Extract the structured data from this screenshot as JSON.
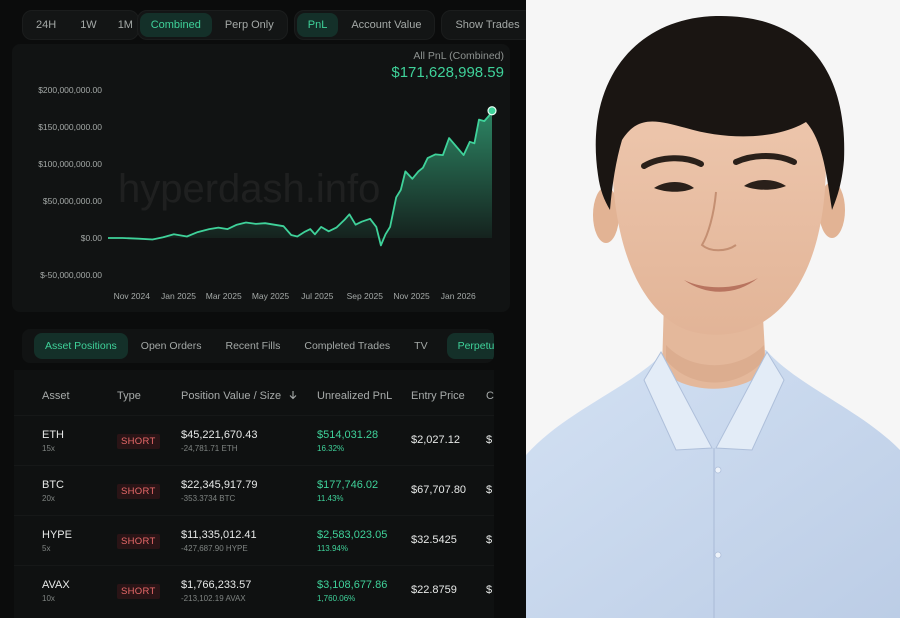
{
  "filters": {
    "time": [
      "24H",
      "1W",
      "1M"
    ],
    "market": [
      "Combined",
      "Perp Only"
    ],
    "metric": [
      "PnL",
      "Account Value"
    ],
    "show_trades": "Show Trades",
    "active_market": "Combined",
    "active_metric": "PnL"
  },
  "chart": {
    "subtitle": "All PnL (Combined)",
    "total": "$171,628,998.59",
    "watermark": "hyperdash.info",
    "accent": "#3fd29a"
  },
  "chart_data": {
    "type": "area",
    "ylim": [
      -50000000,
      200000000
    ],
    "yticks": [
      200000000,
      150000000,
      100000000,
      50000000,
      0,
      -50000000
    ],
    "ytick_labels": [
      "$200,000,000.00",
      "$150,000,000.00",
      "$100,000,000.00",
      "$50,000,000.00",
      "$0.00",
      "$-50,000,000.00"
    ],
    "xtick_labels": [
      "Nov 2024",
      "Jan 2025",
      "Mar 2025",
      "May 2025",
      "Jul 2025",
      "Sep 2025",
      "Nov 2025",
      "Jan 2026"
    ],
    "xtick_dates": [
      "2024-11-01",
      "2025-01-01",
      "2025-03-01",
      "2025-05-01",
      "2025-07-01",
      "2025-09-01",
      "2025-11-01",
      "2026-01-01"
    ],
    "xlim": [
      "2024-10-01",
      "2026-02-14"
    ],
    "grid": false,
    "series": [
      {
        "values": [
          [
            "2024-10-01",
            0
          ],
          [
            "2024-10-20",
            0
          ],
          [
            "2024-11-10",
            -1000000
          ],
          [
            "2024-11-28",
            -2000000
          ],
          [
            "2024-12-12",
            1000000
          ],
          [
            "2024-12-26",
            5000000
          ],
          [
            "2025-01-12",
            2000000
          ],
          [
            "2025-01-26",
            8000000
          ],
          [
            "2025-02-10",
            12000000
          ],
          [
            "2025-02-22",
            14000000
          ],
          [
            "2025-03-06",
            12000000
          ],
          [
            "2025-03-18",
            18000000
          ],
          [
            "2025-03-30",
            21000000
          ],
          [
            "2025-04-12",
            19000000
          ],
          [
            "2025-04-24",
            20000000
          ],
          [
            "2025-05-06",
            18000000
          ],
          [
            "2025-05-18",
            16000000
          ],
          [
            "2025-05-28",
            4000000
          ],
          [
            "2025-06-05",
            2000000
          ],
          [
            "2025-06-14",
            8000000
          ],
          [
            "2025-06-22",
            12000000
          ],
          [
            "2025-06-28",
            5000000
          ],
          [
            "2025-07-06",
            15000000
          ],
          [
            "2025-07-16",
            9000000
          ],
          [
            "2025-07-26",
            14000000
          ],
          [
            "2025-08-06",
            25000000
          ],
          [
            "2025-08-12",
            32000000
          ],
          [
            "2025-08-20",
            18000000
          ],
          [
            "2025-08-28",
            22000000
          ],
          [
            "2025-09-08",
            26000000
          ],
          [
            "2025-09-16",
            15000000
          ],
          [
            "2025-09-22",
            -10000000
          ],
          [
            "2025-09-28",
            5000000
          ],
          [
            "2025-10-04",
            15000000
          ],
          [
            "2025-10-12",
            55000000
          ],
          [
            "2025-10-18",
            65000000
          ],
          [
            "2025-10-24",
            90000000
          ],
          [
            "2025-11-02",
            80000000
          ],
          [
            "2025-11-10",
            90000000
          ],
          [
            "2025-11-16",
            95000000
          ],
          [
            "2025-11-22",
            108000000
          ],
          [
            "2025-12-02",
            113000000
          ],
          [
            "2025-12-12",
            112000000
          ],
          [
            "2025-12-20",
            135000000
          ],
          [
            "2025-12-30",
            123000000
          ],
          [
            "2026-01-08",
            112000000
          ],
          [
            "2026-01-16",
            130000000
          ],
          [
            "2026-01-22",
            128000000
          ],
          [
            "2026-01-28",
            160000000
          ],
          [
            "2026-02-04",
            158000000
          ],
          [
            "2026-02-10",
            165000000
          ],
          [
            "2026-02-14",
            172000000
          ]
        ]
      }
    ]
  },
  "tabs": [
    "Asset Positions",
    "Open Orders",
    "Recent Fills",
    "Completed Trades",
    "TV",
    "Perpetual"
  ],
  "table": {
    "headers": [
      "Asset",
      "Type",
      "Position Value / Size",
      "Unrealized PnL",
      "Entry Price",
      "C"
    ],
    "sort_icon": "arrow-down-icon",
    "rows": [
      {
        "asset": "ETH",
        "leverage": "15x",
        "type": "SHORT",
        "value": "$45,221,670.43",
        "size": "-24,781.71 ETH",
        "pnl": "$514,031.28",
        "pnl_pct": "16.32%",
        "entry": "$2,027.12",
        "current": "$"
      },
      {
        "asset": "BTC",
        "leverage": "20x",
        "type": "SHORT",
        "value": "$22,345,917.79",
        "size": "-353.3734 BTC",
        "pnl": "$177,746.02",
        "pnl_pct": "11.43%",
        "entry": "$67,707.80",
        "current": "$"
      },
      {
        "asset": "HYPE",
        "leverage": "5x",
        "type": "SHORT",
        "value": "$11,335,012.41",
        "size": "-427,687.90 HYPE",
        "pnl": "$2,583,023.05",
        "pnl_pct": "113.94%",
        "entry": "$32.5425",
        "current": "$"
      },
      {
        "asset": "AVAX",
        "leverage": "10x",
        "type": "SHORT",
        "value": "$1,766,233.57",
        "size": "-213,102.19 AVAX",
        "pnl": "$3,108,677.86",
        "pnl_pct": "1,760.06%",
        "entry": "$22.8759",
        "current": "$"
      }
    ]
  },
  "photo": {
    "subject": "portrait of a young man in a light blue collared shirt",
    "bg": "#f7f7f7",
    "shirt": "#c9d9ef"
  }
}
